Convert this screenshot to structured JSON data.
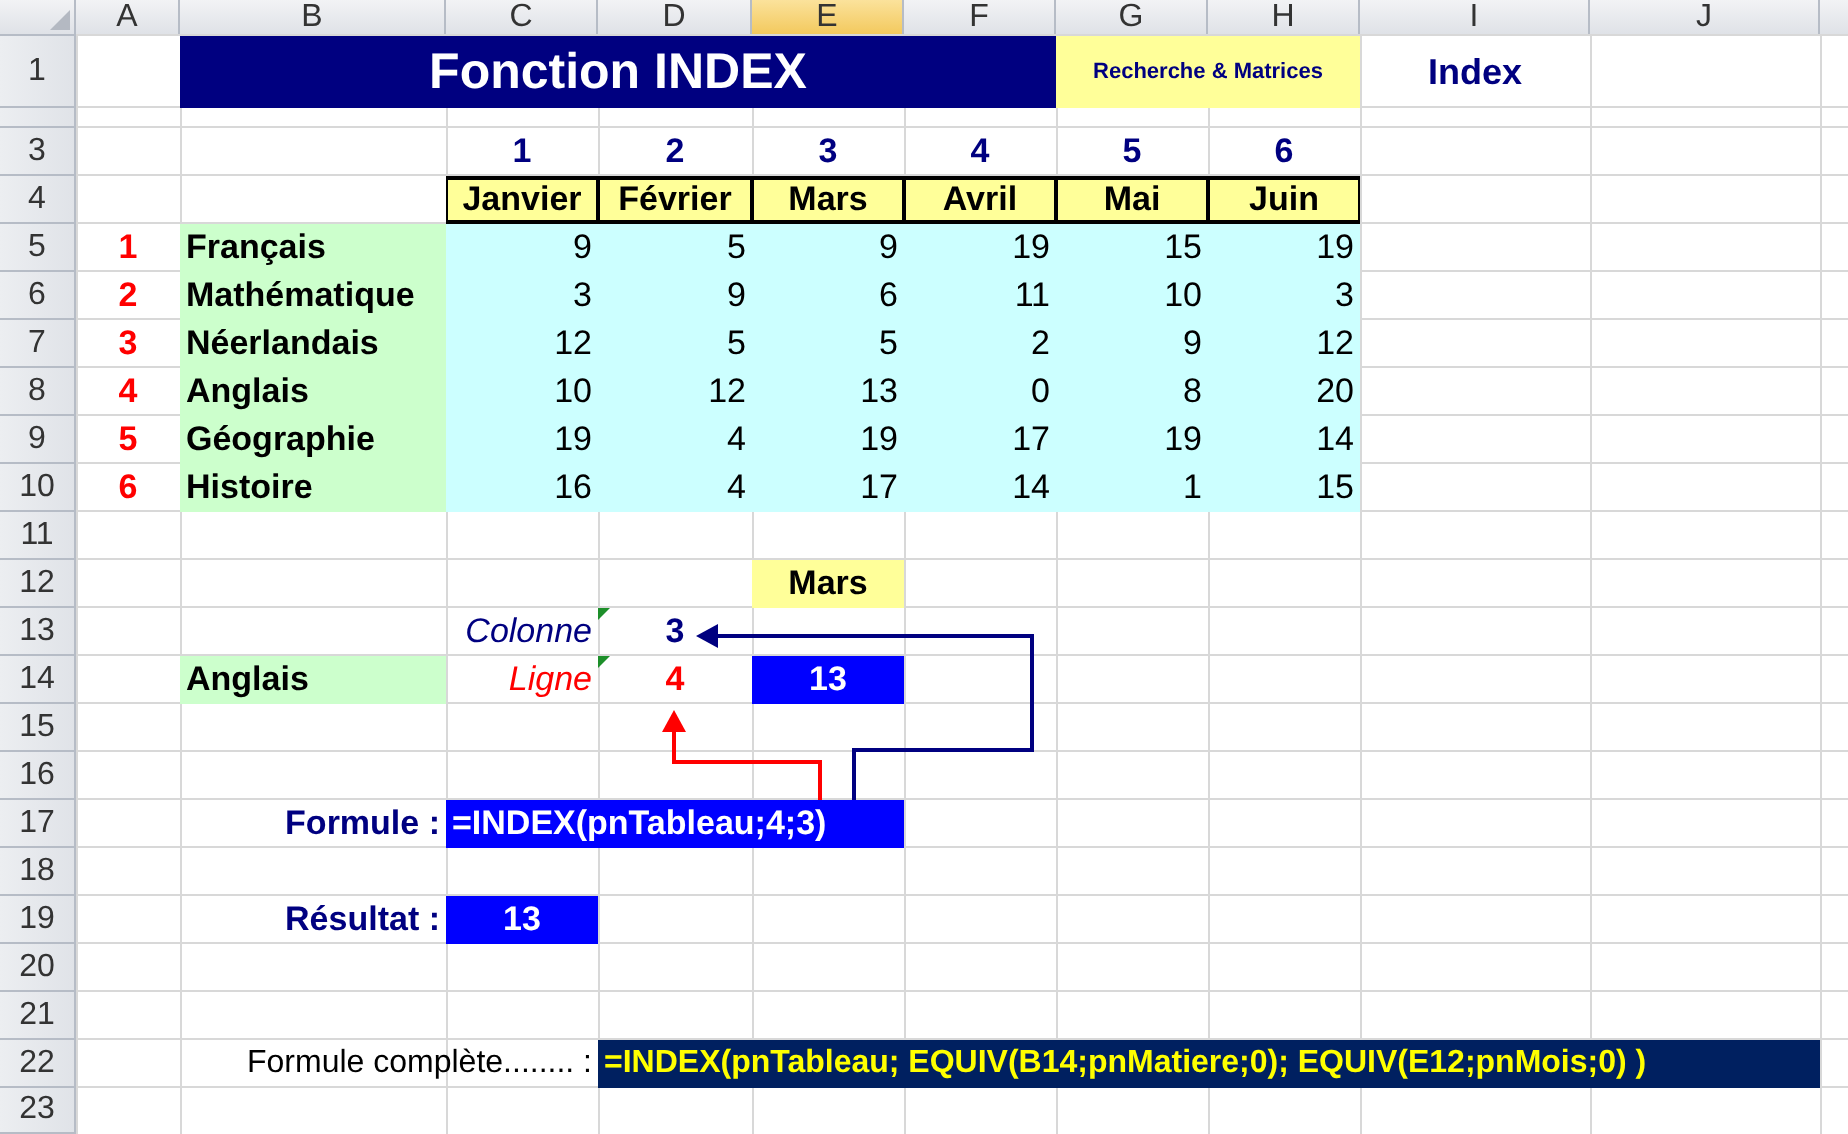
{
  "column_headers": [
    {
      "label": "A",
      "selected": false
    },
    {
      "label": "B",
      "selected": false
    },
    {
      "label": "C",
      "selected": false
    },
    {
      "label": "D",
      "selected": false
    },
    {
      "label": "E",
      "selected": true
    },
    {
      "label": "F",
      "selected": false
    },
    {
      "label": "G",
      "selected": false
    },
    {
      "label": "H",
      "selected": false
    },
    {
      "label": "I",
      "selected": false
    },
    {
      "label": "J",
      "selected": false
    }
  ],
  "row_headers": [
    "1",
    "3",
    "4",
    "5",
    "6",
    "7",
    "8",
    "9",
    "10",
    "11",
    "12",
    "13",
    "14",
    "15",
    "16",
    "17",
    "18",
    "19",
    "20",
    "21",
    "22",
    "23"
  ],
  "title": "Fonction INDEX",
  "category": "Recherche & Matrices",
  "sheet_label": "Index",
  "month_numbers": [
    "1",
    "2",
    "3",
    "4",
    "5",
    "6"
  ],
  "months": [
    "Janvier",
    "Février",
    "Mars",
    "Avril",
    "Mai",
    "Juin"
  ],
  "subjects": [
    {
      "number": "1",
      "name": "Français",
      "values": [
        "9",
        "5",
        "9",
        "19",
        "15",
        "19"
      ]
    },
    {
      "number": "2",
      "name": "Mathématique",
      "values": [
        "3",
        "9",
        "6",
        "11",
        "10",
        "3"
      ]
    },
    {
      "number": "3",
      "name": "Néerlandais",
      "values": [
        "12",
        "5",
        "5",
        "2",
        "9",
        "12"
      ]
    },
    {
      "number": "4",
      "name": "Anglais",
      "values": [
        "10",
        "12",
        "13",
        "0",
        "8",
        "20"
      ]
    },
    {
      "number": "5",
      "name": "Géographie",
      "values": [
        "19",
        "4",
        "19",
        "17",
        "19",
        "14"
      ]
    },
    {
      "number": "6",
      "name": "Histoire",
      "values": [
        "16",
        "4",
        "17",
        "14",
        "1",
        "15"
      ]
    }
  ],
  "lookup": {
    "month": "Mars",
    "column_label": "Colonne",
    "column_value": "3",
    "subject": "Anglais",
    "row_label": "Ligne",
    "row_value": "4",
    "cell_value": "13"
  },
  "formula": {
    "label": "Formule :",
    "value": "=INDEX(pnTableau;4;3)"
  },
  "result": {
    "label": "Résultat :",
    "value": "13"
  },
  "full_formula": {
    "label": "Formule complète........ :",
    "value": "=INDEX(pnTableau; EQUIV(B14;pnMatiere;0); EQUIV(E12;pnMois;0) )"
  }
}
